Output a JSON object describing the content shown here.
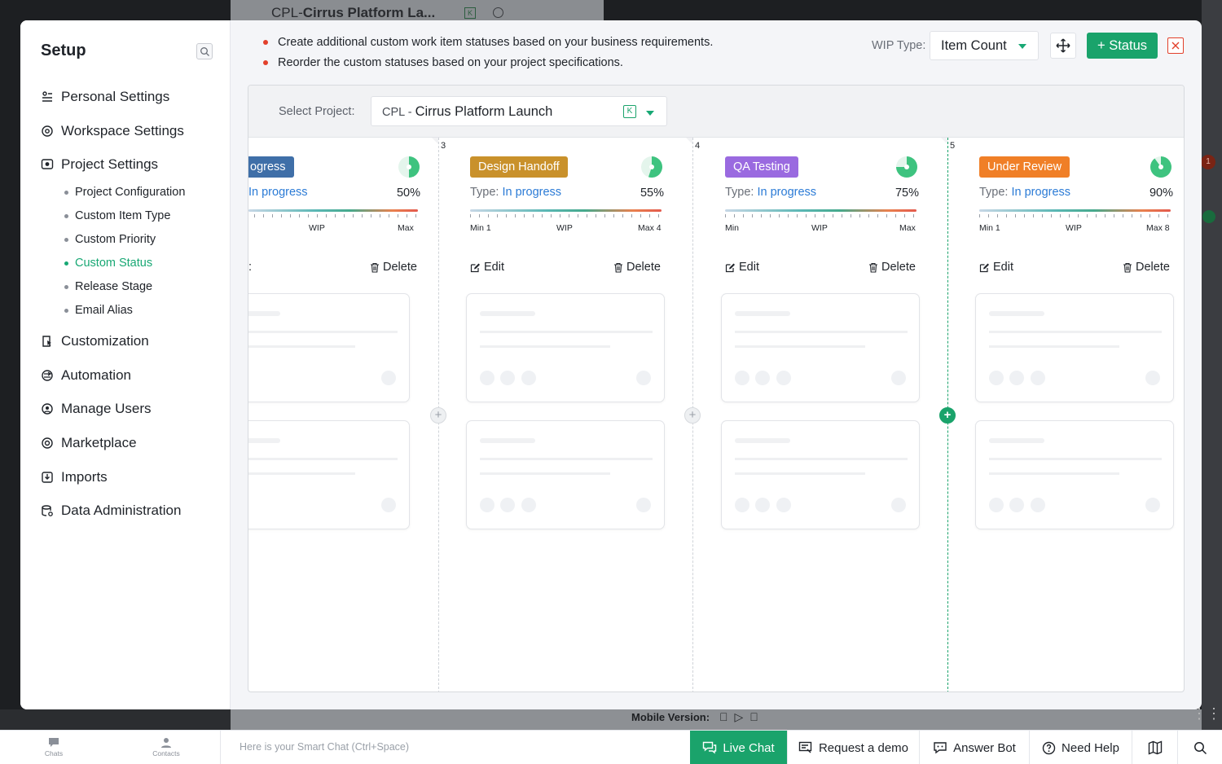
{
  "background": {
    "tab_title_prefix": "CPL-",
    "tab_title": "Cirrus Platform La...",
    "badge_count": "1",
    "mobile_label": "Mobile Version:"
  },
  "sidebar": {
    "title": "Setup",
    "items": [
      {
        "label": "Personal Settings",
        "icon": "personal-settings-icon"
      },
      {
        "label": "Workspace Settings",
        "icon": "workspace-settings-icon"
      },
      {
        "label": "Project Settings",
        "icon": "project-settings-icon"
      }
    ],
    "sub_items": [
      {
        "label": "Project Configuration"
      },
      {
        "label": "Custom Item Type"
      },
      {
        "label": "Custom Priority"
      },
      {
        "label": "Custom Status",
        "active": true
      },
      {
        "label": "Release Stage"
      },
      {
        "label": "Email Alias"
      }
    ],
    "items_after": [
      {
        "label": "Customization",
        "icon": "customization-icon"
      },
      {
        "label": "Automation",
        "icon": "automation-icon"
      },
      {
        "label": "Manage Users",
        "icon": "manage-users-icon"
      },
      {
        "label": "Marketplace",
        "icon": "marketplace-icon"
      },
      {
        "label": "Imports",
        "icon": "imports-icon"
      },
      {
        "label": "Data Administration",
        "icon": "data-administration-icon"
      }
    ]
  },
  "header": {
    "tips": [
      "Create additional custom work item statuses based on your business requirements.",
      "Reorder the custom statuses based on your project specifications."
    ],
    "wip_type_label": "WIP Type:",
    "wip_type_value": "Item Count",
    "add_status_label": "+ Status"
  },
  "board": {
    "select_project_label": "Select Project:",
    "project_prefix": "CPL - ",
    "project_name": "Cirrus Platform Launch",
    "project_key_badge": "K",
    "columns": [
      {
        "number": "",
        "status": "ogress",
        "color": "#3f6fa8",
        "type_label": "",
        "type_value": "In progress",
        "percent": "50%",
        "fill": 0.5,
        "min": "",
        "wip": "WIP",
        "max": "Max",
        "edit": ":",
        "delete": "Delete"
      },
      {
        "number": "3",
        "status": "Design Handoff",
        "color": "#c9912b",
        "type_label": "Type:",
        "type_value": "In progress",
        "percent": "55%",
        "fill": 0.55,
        "min": "Min 1",
        "wip": "WIP",
        "max": "Max 4",
        "edit": "Edit",
        "delete": "Delete"
      },
      {
        "number": "4",
        "status": "QA Testing",
        "color": "#9a6ae0",
        "type_label": "Type:",
        "type_value": "In progress",
        "percent": "75%",
        "fill": 0.75,
        "min": "Min",
        "wip": "WIP",
        "max": "Max",
        "edit": "Edit",
        "delete": "Delete"
      },
      {
        "number": "5",
        "status": "Under Review",
        "color": "#f07f27",
        "type_label": "Type:",
        "type_value": "In progress",
        "percent": "90%",
        "fill": 0.9,
        "min": "Min 1",
        "wip": "WIP",
        "max": "Max 8",
        "edit": "Edit",
        "delete": "Delete"
      }
    ]
  },
  "bottombar": {
    "chats": "Chats",
    "contacts": "Contacts",
    "smart_chat_placeholder": "Here is your Smart Chat (Ctrl+Space)",
    "live_chat": "Live Chat",
    "request_demo": "Request a demo",
    "answer_bot": "Answer Bot",
    "need_help": "Need Help"
  },
  "colors": {
    "accent_green": "#1aa36b",
    "link_blue": "#2b7bd6",
    "danger_red": "#e2402b"
  }
}
